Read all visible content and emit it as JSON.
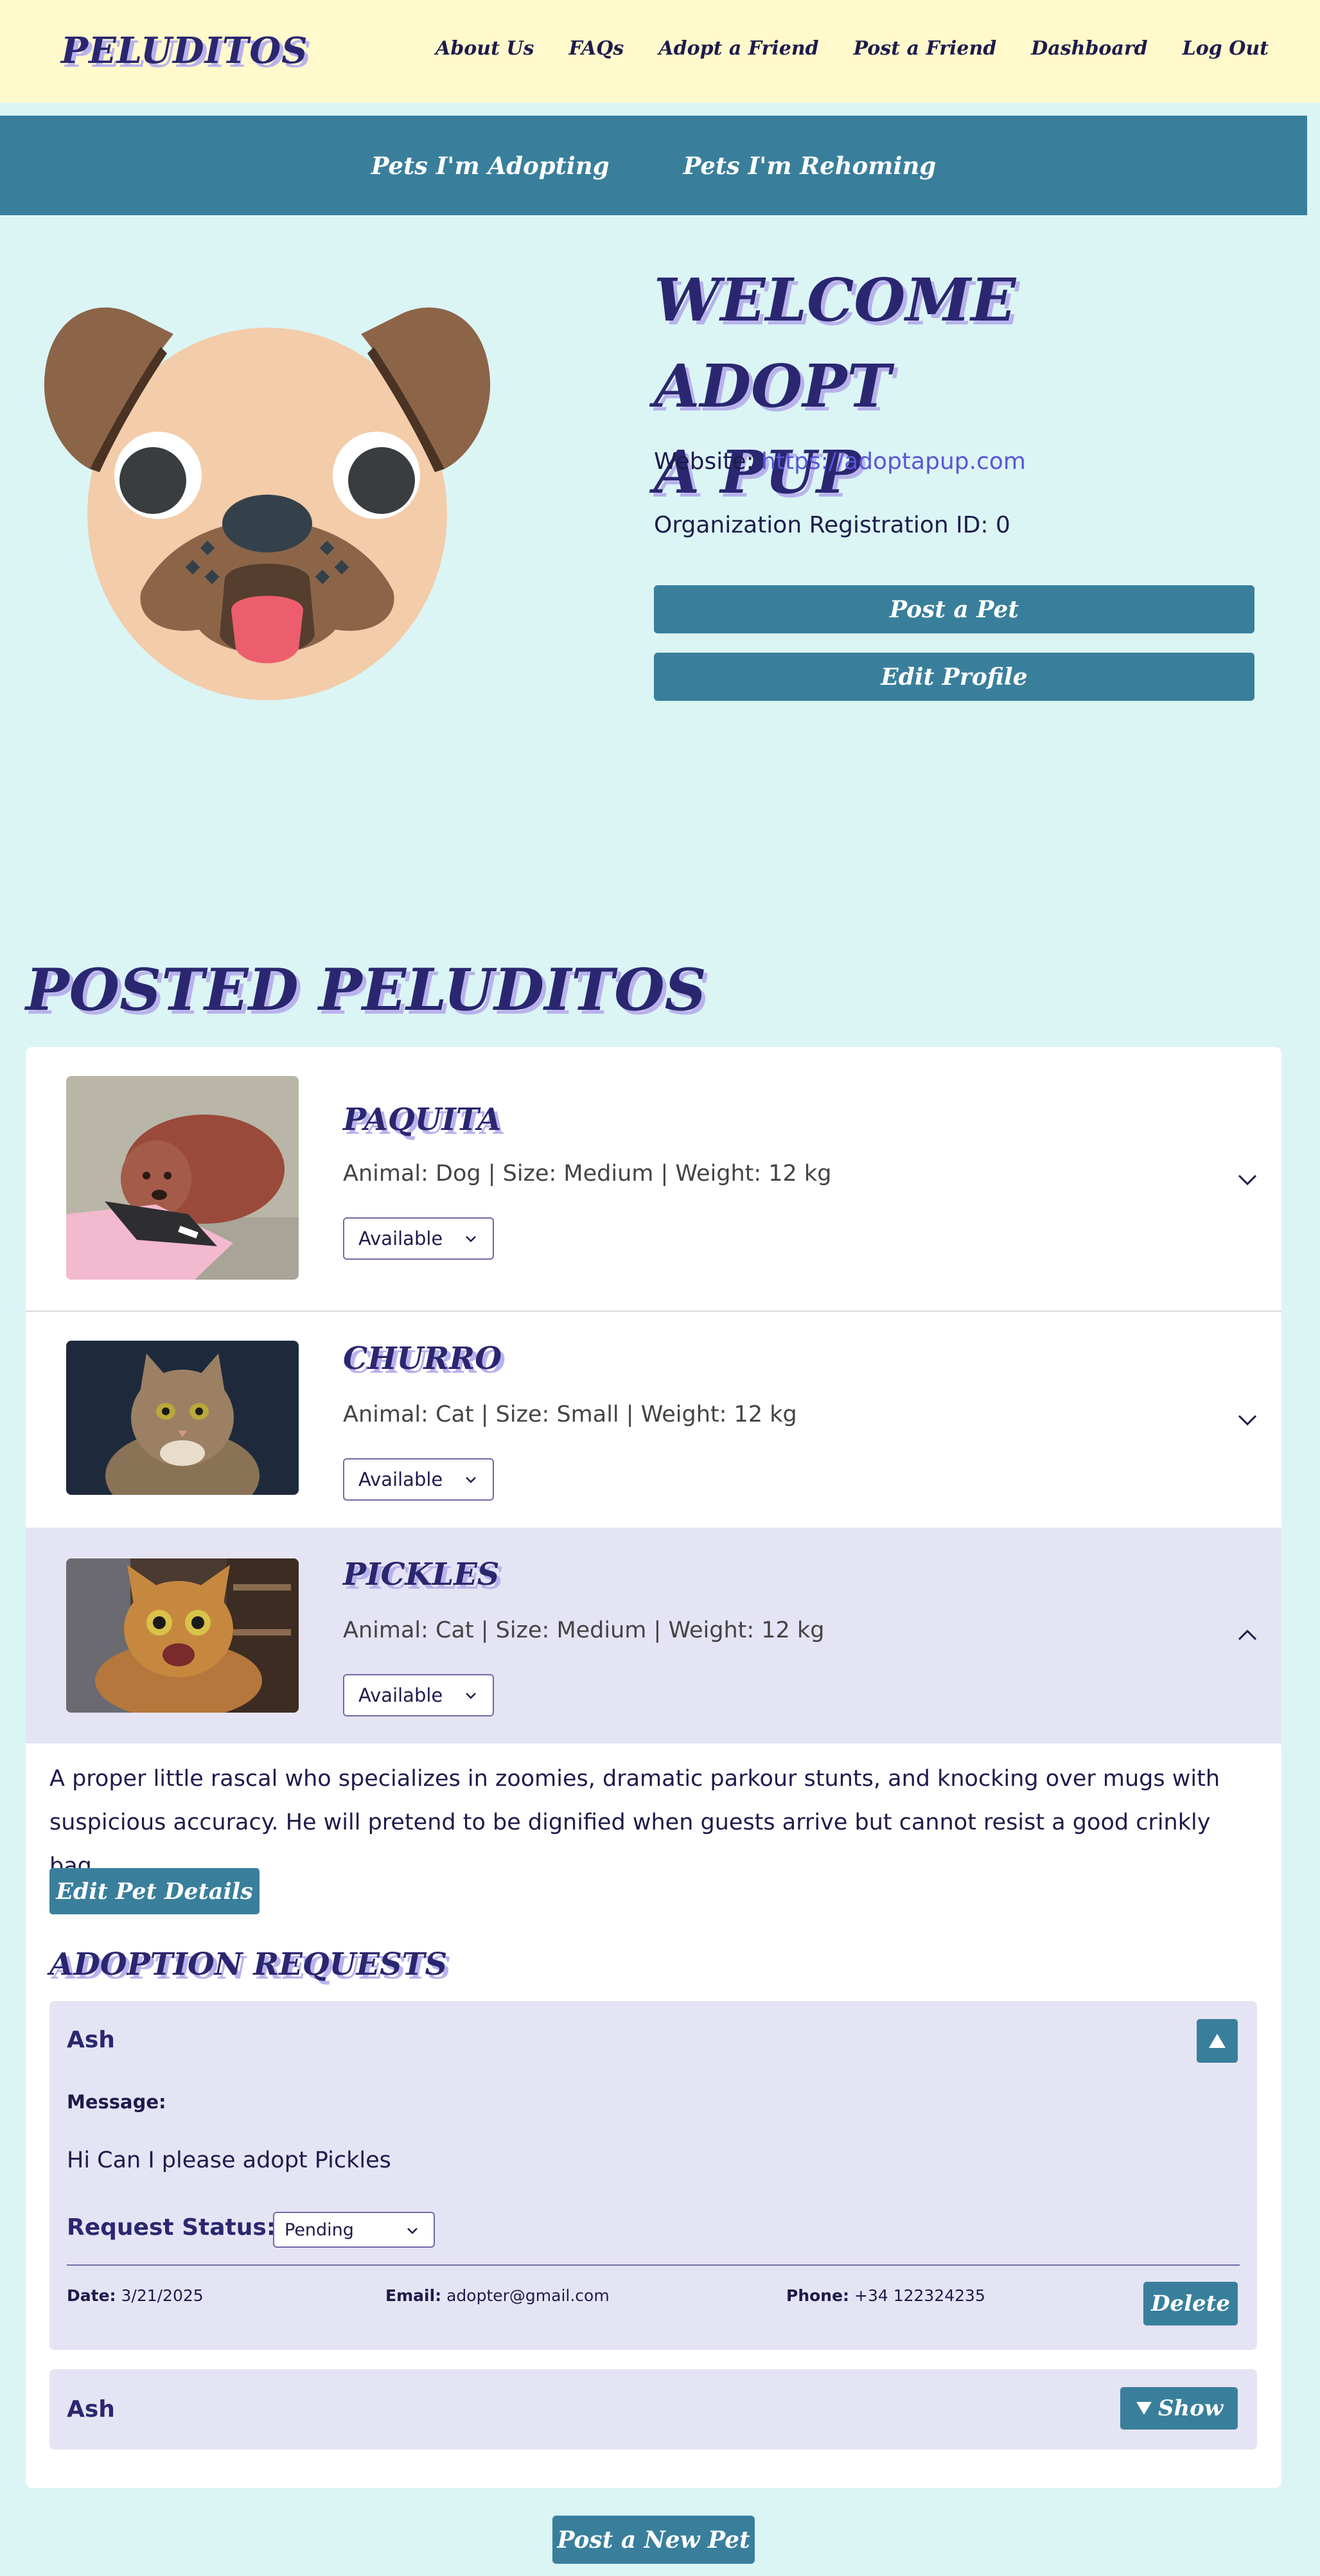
{
  "nav": {
    "brand": "PELUDITOS",
    "links": [
      "About Us",
      "FAQs",
      "Adopt a Friend",
      "Post a Friend",
      "Dashboard",
      "Log Out"
    ]
  },
  "subnav": {
    "tabs": [
      "Pets I'm Adopting",
      "Pets I'm Rehoming"
    ]
  },
  "profile": {
    "welcome_line1": "WELCOME ADOPT",
    "welcome_line2": "A PUP",
    "website_label": "Website:",
    "website_url": "https://adoptapup.com",
    "registration": "Organization Registration ID: 0",
    "post_pet_button": "Post a Pet",
    "edit_profile_button": "Edit Profile",
    "avatar_icon": "pug-face-icon"
  },
  "posted": {
    "title": "POSTED PELUDITOS",
    "pets": [
      {
        "name": "PAQUITA",
        "meta": "Animal: Dog | Size: Medium | Weight: 12 kg",
        "status": "Available",
        "expanded": false
      },
      {
        "name": "CHURRO",
        "meta": "Animal: Cat | Size: Small | Weight: 12 kg",
        "status": "Available",
        "expanded": false
      },
      {
        "name": "PICKLES",
        "meta": "Animal: Cat | Size: Medium | Weight: 12 kg",
        "status": "Available",
        "expanded": true
      }
    ],
    "description": "A proper little rascal who specializes in zoomies, dramatic parkour stunts, and knocking over mugs with suspicious accuracy. He will pretend to be dignified when guests arrive but cannot resist a good crinkly bag.",
    "edit_pet_button": "Edit Pet Details",
    "requests_title": "ADOPTION REQUESTS",
    "requests": [
      {
        "name": "Ash",
        "message_label": "Message:",
        "message": "Hi Can I please adopt Pickles",
        "status_label": "Request Status:",
        "status": "Pending",
        "date_label": "Date:",
        "date": "3/21/2025",
        "email_label": "Email:",
        "email": "adopter@gmail.com",
        "phone_label": "Phone:",
        "phone": "+34 122324235",
        "delete_button": "Delete"
      },
      {
        "name": "Ash",
        "show_button": "Show"
      }
    ]
  },
  "footer": {
    "post_new_button": "Post a New Pet"
  },
  "colors": {
    "background": "#dbf5f5",
    "nav_bg": "#fff9cc",
    "accent": "#397f9c",
    "heading": "#2a2770",
    "heading_shadow": "#b9b2ec",
    "highlight_row": "#e5e4f4",
    "link": "#5a55d6"
  }
}
